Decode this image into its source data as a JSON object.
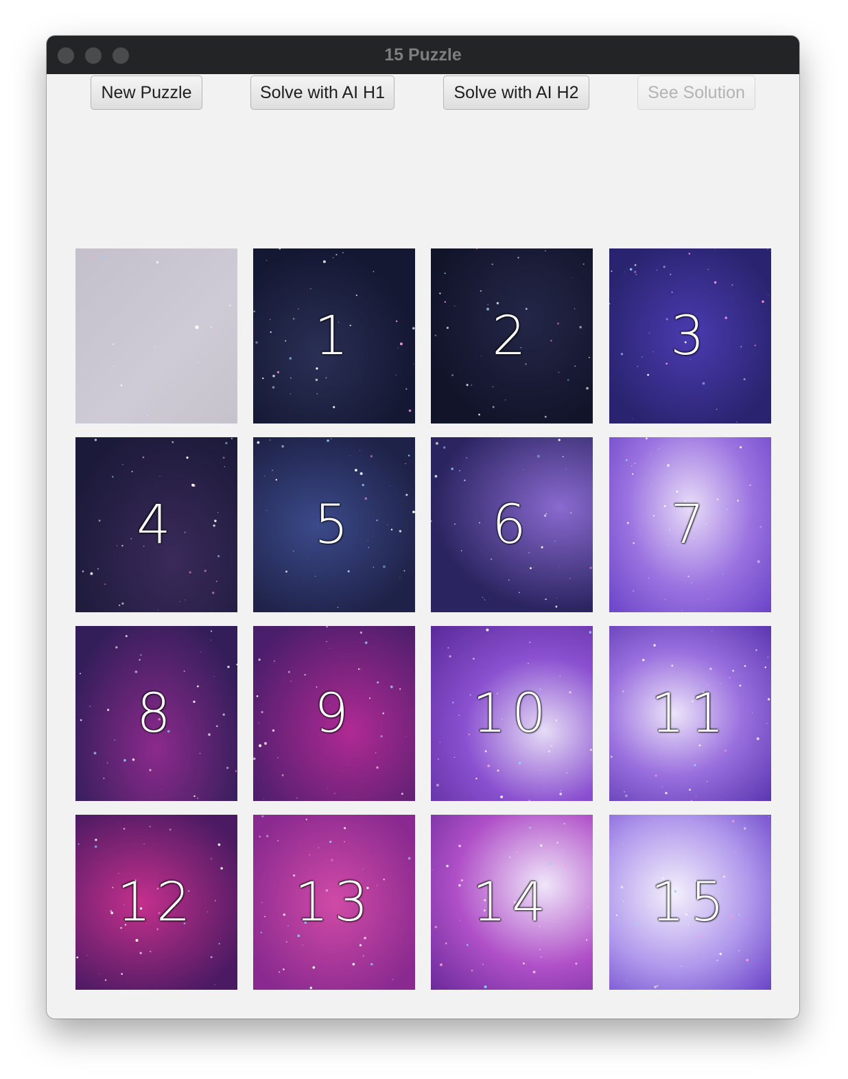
{
  "window": {
    "title": "15 Puzzle"
  },
  "toolbar": {
    "buttons": [
      {
        "label": "New Puzzle",
        "enabled": true
      },
      {
        "label": "Solve with AI H1",
        "enabled": true
      },
      {
        "label": "Solve with AI H2",
        "enabled": true
      },
      {
        "label": "See Solution",
        "enabled": false
      }
    ]
  },
  "board": {
    "rows": 4,
    "cols": 4,
    "tiles": [
      "",
      "1",
      "2",
      "3",
      "4",
      "5",
      "6",
      "7",
      "8",
      "9",
      "10",
      "11",
      "12",
      "13",
      "14",
      "15"
    ],
    "empty_tile_label": "",
    "colors": {
      "deep_space": "#171a35",
      "violet": "#5a2fb0",
      "magenta": "#c02a9a",
      "lavender": "#d8c8f0",
      "empty_overlay": "#c8c4cf"
    }
  }
}
